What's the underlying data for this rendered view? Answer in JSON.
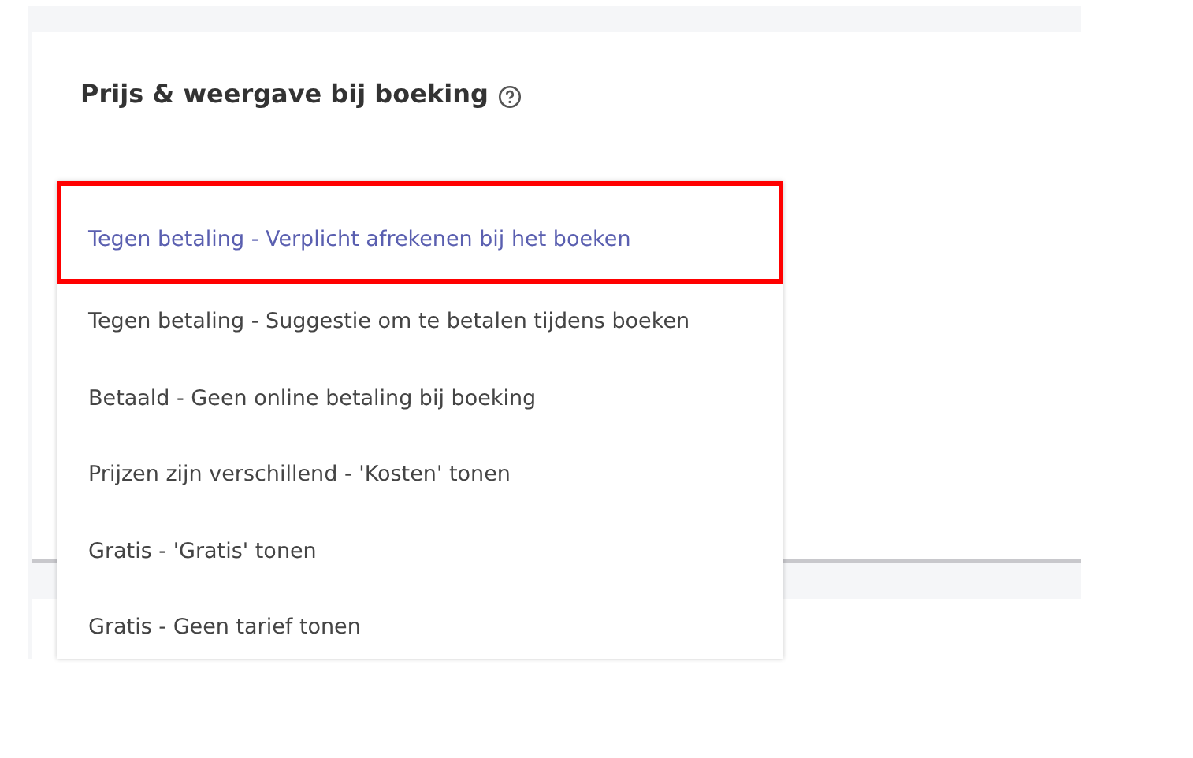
{
  "section": {
    "title": "Prijs & weergave bij boeking",
    "help_icon": true
  },
  "dropdown": {
    "options": [
      {
        "label": "Tegen betaling - Verplicht afrekenen bij het boeken",
        "selected": true
      },
      {
        "label": "Tegen betaling - Suggestie om te betalen tijdens boeken",
        "selected": false
      },
      {
        "label": "Betaald - Geen online betaling bij boeking",
        "selected": false
      },
      {
        "label": "Prijzen zijn verschillend - 'Kosten' tonen",
        "selected": false
      },
      {
        "label": "Gratis - 'Gratis' tonen",
        "selected": false
      },
      {
        "label": "Gratis - Geen tarief tonen",
        "selected": false
      }
    ]
  }
}
